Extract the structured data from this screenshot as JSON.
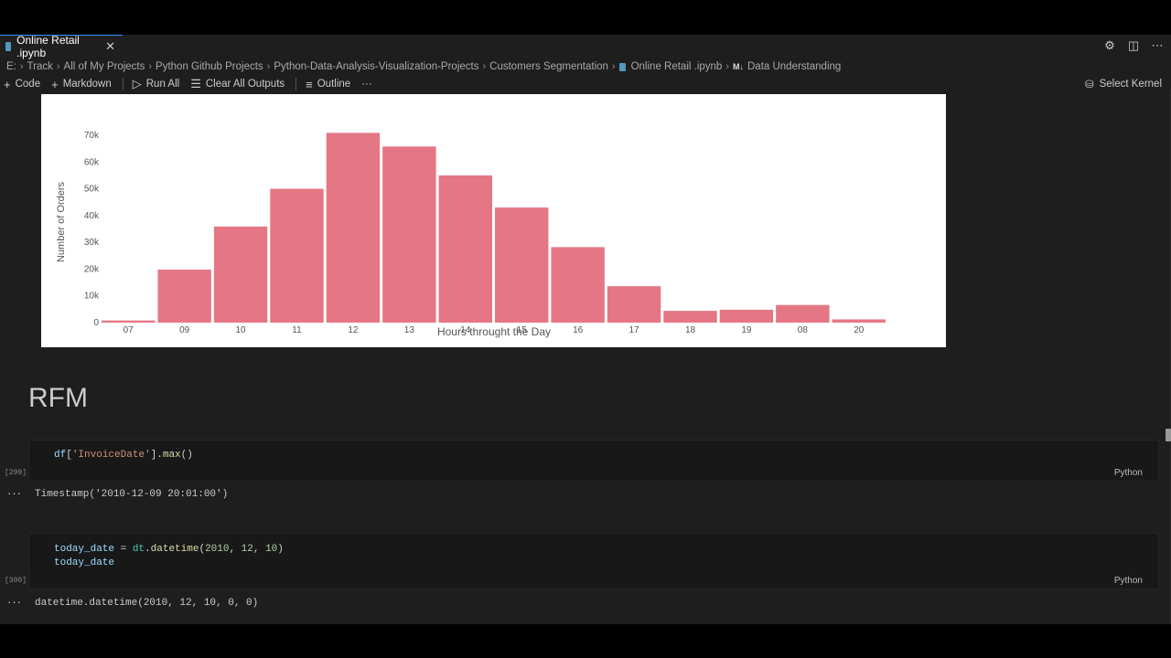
{
  "tab": {
    "title": "Online Retail .ipynb",
    "close_glyph": "✕"
  },
  "tab_actions": [
    "gear-icon",
    "split-editor-icon",
    "more-icon"
  ],
  "breadcrumb": {
    "items": [
      "E:",
      "Track",
      "All of My Projects",
      "Python Github Projects",
      "Python-Data-Analysis-Visualization-Projects",
      "Customers Segmentation",
      "Online Retail .ipynb",
      "Data Understanding"
    ],
    "md_badge": "M↓",
    "separator": "›"
  },
  "toolbar": {
    "code": "Code",
    "markdown": "Markdown",
    "run_all": "Run All",
    "clear_all_outputs": "Clear All Outputs",
    "outline": "Outline",
    "more": "···",
    "select_kernel": "Select Kernel"
  },
  "chart_data": {
    "type": "bar",
    "categories": [
      "07",
      "09",
      "10",
      "11",
      "12",
      "13",
      "14",
      "15",
      "16",
      "17",
      "18",
      "19",
      "08",
      "20"
    ],
    "values": [
      800,
      19800,
      35900,
      50000,
      70900,
      65800,
      55000,
      43000,
      28200,
      13600,
      4400,
      4800,
      6600,
      1200
    ],
    "xlabel": "Hours throught the Day",
    "ylabel": "Number of Orders",
    "yticks": [
      "0",
      "10k",
      "20k",
      "30k",
      "40k",
      "50k",
      "60k",
      "70k"
    ],
    "ylim": [
      0,
      72000
    ],
    "bar_color": "#e57785",
    "grid": false
  },
  "markdown_heading": "RFM",
  "cells": [
    {
      "number": "[299]",
      "language": "Python",
      "code_lines": [
        [
          {
            "t": "df",
            "c": "var"
          },
          {
            "t": "[",
            "c": "plain"
          },
          {
            "t": "'InvoiceDate'",
            "c": "str"
          },
          {
            "t": "].",
            "c": "plain"
          },
          {
            "t": "max",
            "c": "fn"
          },
          {
            "t": "()",
            "c": "plain"
          }
        ]
      ],
      "output": "Timestamp('2010-12-09 20:01:00')"
    },
    {
      "number": "[300]",
      "language": "Python",
      "code_lines": [
        [
          {
            "t": "today_date",
            "c": "var"
          },
          {
            "t": " = ",
            "c": "plain"
          },
          {
            "t": "dt",
            "c": "mod"
          },
          {
            "t": ".",
            "c": "plain"
          },
          {
            "t": "datetime",
            "c": "fn"
          },
          {
            "t": "(",
            "c": "plain"
          },
          {
            "t": "2010",
            "c": "num"
          },
          {
            "t": ", ",
            "c": "plain"
          },
          {
            "t": "12",
            "c": "num"
          },
          {
            "t": ", ",
            "c": "plain"
          },
          {
            "t": "10",
            "c": "num"
          },
          {
            "t": ")",
            "c": "plain"
          }
        ],
        [
          {
            "t": "today_date",
            "c": "var"
          }
        ]
      ],
      "output": "datetime.datetime(2010, 12, 10, 0, 0)"
    }
  ],
  "output_menu": "···"
}
